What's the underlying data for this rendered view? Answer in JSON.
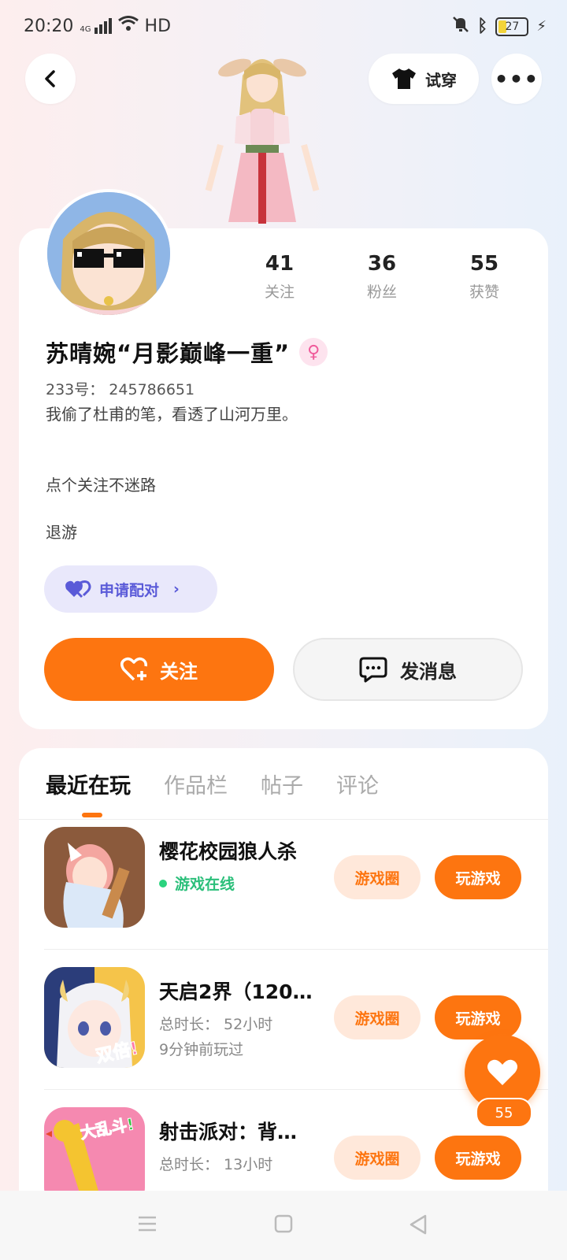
{
  "status_bar": {
    "time": "20:20",
    "network": "4G",
    "hd": "HD",
    "battery": "27"
  },
  "header": {
    "try_on_label": "试穿",
    "more_label": "•••"
  },
  "stats": [
    {
      "value": "41",
      "label": "关注"
    },
    {
      "value": "36",
      "label": "粉丝"
    },
    {
      "value": "55",
      "label": "获赞"
    }
  ],
  "profile": {
    "name": "苏晴婉“月影巅峰一重”",
    "gender_symbol": "♀",
    "uid": "233号：  245786651",
    "bio_line1": "我偷了杜甫的笔，看透了山河万里。",
    "bio_line2": "点个关注不迷路",
    "bio_line3": "退游",
    "match_label": "申请配对",
    "follow_label": "关注",
    "message_label": "发消息"
  },
  "tabs": [
    "最近在玩",
    "作品栏",
    "帖子",
    "评论"
  ],
  "games": [
    {
      "title": "樱花校园狼人杀",
      "status": "游戏在线",
      "circle_label": "游戏圈",
      "play_label": "玩游戏"
    },
    {
      "title": "天启2界（120…",
      "duration": "总时长：  52小时",
      "last_played": "9分钟前玩过",
      "badge": "双倍!",
      "circle_label": "游戏圈",
      "play_label": "玩游戏"
    },
    {
      "title": "射击派对：背…",
      "duration": "总时长：  13小时",
      "badge": "大乱斗!",
      "circle_label": "游戏圈",
      "play_label": "玩游戏"
    }
  ],
  "like": {
    "count": "55"
  },
  "colors": {
    "accent": "#fd7510",
    "online": "#2bbf7a",
    "match": "#5a5ad8"
  }
}
